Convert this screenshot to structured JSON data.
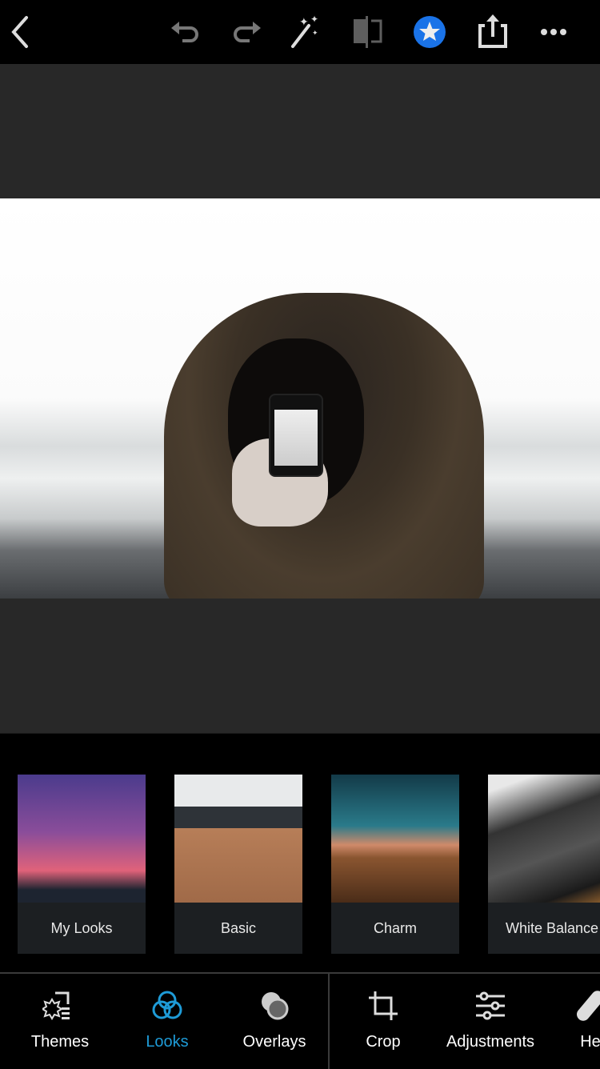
{
  "toolbar": {
    "icons": [
      "back-icon",
      "undo-icon",
      "redo-icon",
      "magic-wand-icon",
      "compare-icon",
      "star-icon",
      "share-icon",
      "more-icon"
    ],
    "accent": "#1a73e8"
  },
  "looks": [
    {
      "label": "My Looks"
    },
    {
      "label": "Basic"
    },
    {
      "label": "Charm"
    },
    {
      "label": "White Balance"
    }
  ],
  "nav": {
    "items": [
      {
        "label": "Themes"
      },
      {
        "label": "Looks"
      },
      {
        "label": "Overlays"
      },
      {
        "label": "Crop"
      },
      {
        "label": "Adjustments"
      },
      {
        "label": "He"
      }
    ],
    "active": "Looks",
    "active_color": "#1e9bd7"
  }
}
